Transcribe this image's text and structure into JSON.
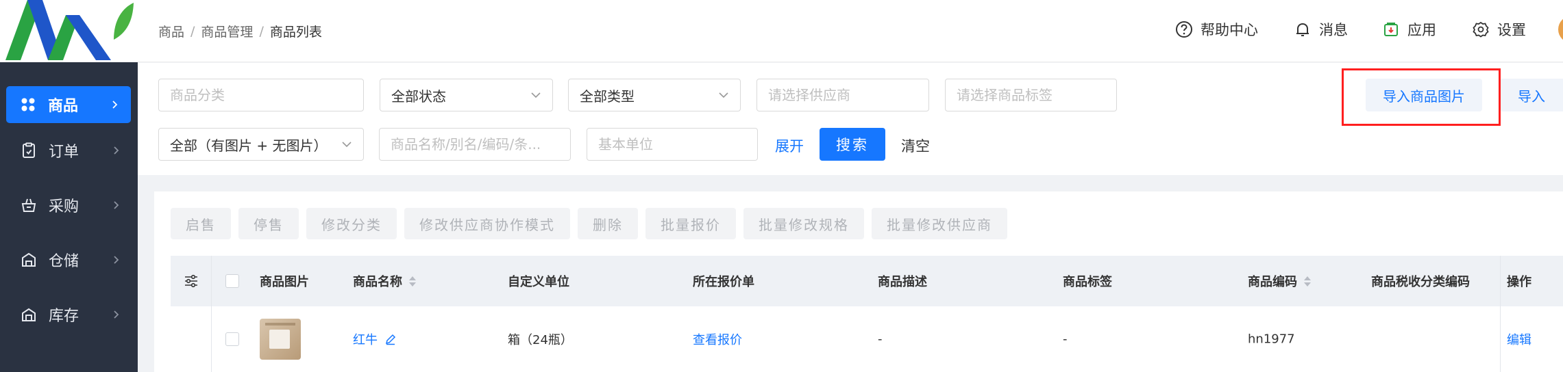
{
  "breadcrumb": {
    "level1": "商品",
    "level2": "商品管理",
    "current": "商品列表"
  },
  "header": {
    "help": "帮助中心",
    "messages": "消息",
    "apps": "应用",
    "settings": "设置"
  },
  "sidebar": {
    "items": [
      {
        "label": "商品",
        "icon": "grid-icon",
        "active": true
      },
      {
        "label": "订单",
        "icon": "clipboard-icon",
        "active": false
      },
      {
        "label": "采购",
        "icon": "basket-icon",
        "active": false
      },
      {
        "label": "仓储",
        "icon": "warehouse-icon",
        "active": false
      },
      {
        "label": "库存",
        "icon": "stock-icon",
        "active": false
      }
    ]
  },
  "filters": {
    "category_placeholder": "商品分类",
    "status_value": "全部状态",
    "type_value": "全部类型",
    "supplier_placeholder": "请选择供应商",
    "tag_placeholder": "请选择商品标签",
    "image_filter_value": "全部（有图片 + 无图片）",
    "name_placeholder": "商品名称/别名/编码/条...",
    "unit_placeholder": "基本单位",
    "expand": "展开",
    "search": "搜索",
    "clear": "清空",
    "import_images": "导入商品图片",
    "import": "导入"
  },
  "actions": [
    "启售",
    "停售",
    "修改分类",
    "修改供应商协作模式",
    "删除",
    "批量报价",
    "批量修改规格",
    "批量修改供应商"
  ],
  "table": {
    "columns": {
      "image": "商品图片",
      "name": "商品名称",
      "unit": "自定义单位",
      "quote": "所在报价单",
      "desc": "商品描述",
      "tag": "商品标签",
      "code": "商品编码",
      "tax": "商品税收分类编码",
      "op": "操作"
    },
    "rows": [
      {
        "name": "红牛",
        "unit": "箱（24瓶）",
        "quote": "查看报价",
        "desc": "-",
        "tag": "-",
        "code": "hn1977",
        "tax": "",
        "op": "编辑"
      }
    ]
  },
  "colors": {
    "primary": "#1677ff",
    "sidebar": "#2a3241",
    "highlight": "#ff1f1f"
  }
}
